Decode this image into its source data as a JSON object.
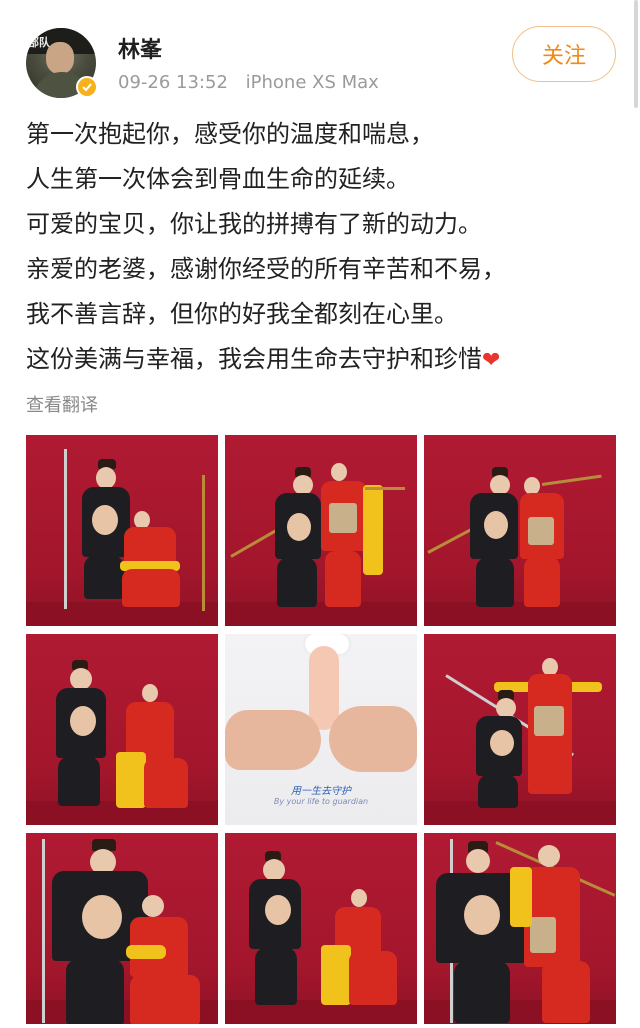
{
  "header": {
    "username": "林峯",
    "timestamp": "09-26 13:52",
    "device": "iPhone XS Max",
    "follow_label": "关注",
    "avatar_text": "部队"
  },
  "post": {
    "lines": [
      "第一次抱起你，感受你的温度和喘息，",
      "人生第一次体会到骨血生命的延续。",
      "可爱的宝贝，你让我的拼搏有了新的动力。",
      "亲爱的老婆，感谢你经受的所有辛苦和不易，",
      "我不善言辞，但你的好我全都刻在心里。",
      "这份美满与幸福，我会用生命去守护和珍惜"
    ],
    "heart_emoji": "❤",
    "translate_label": "查看翻译"
  },
  "photos": {
    "center_caption": "用一生去守护",
    "center_caption_sub": "By your life to guardian"
  },
  "colors": {
    "follow_accent": "#f08a14",
    "photo_backdrop": "#a8182e",
    "verified_badge": "#f6b11c"
  }
}
